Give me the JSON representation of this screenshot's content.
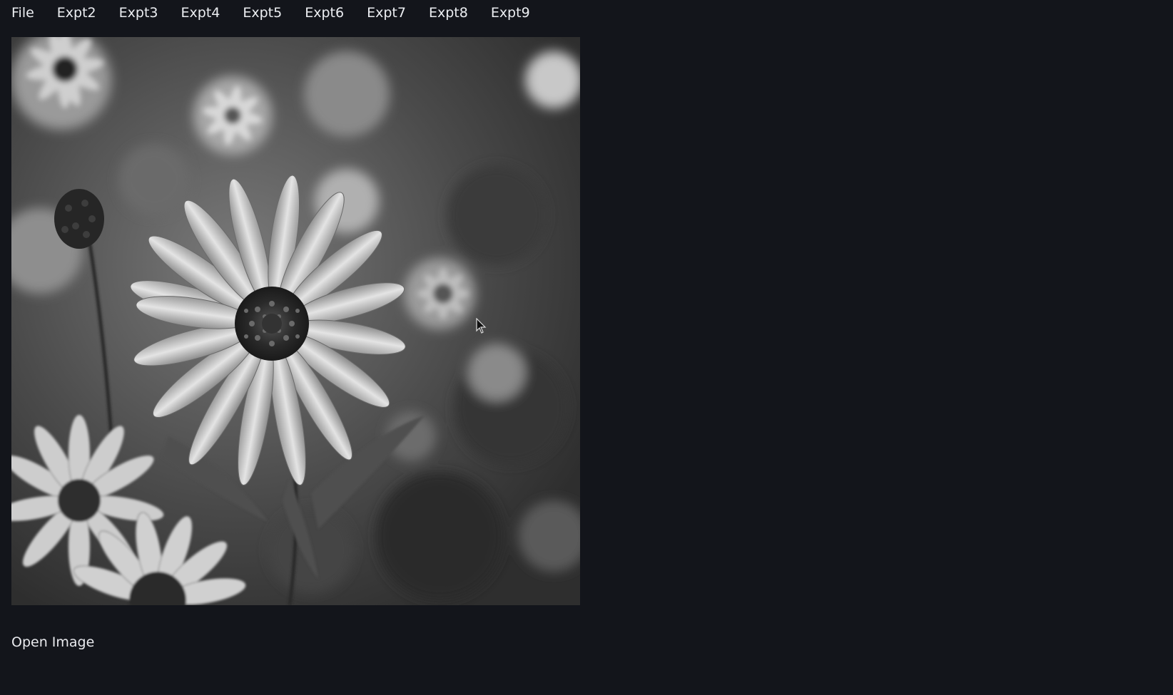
{
  "menubar": {
    "items": [
      {
        "label": "File"
      },
      {
        "label": "Expt2"
      },
      {
        "label": "Expt3"
      },
      {
        "label": "Expt4"
      },
      {
        "label": "Expt5"
      },
      {
        "label": "Expt6"
      },
      {
        "label": "Expt7"
      },
      {
        "label": "Expt8"
      },
      {
        "label": "Expt9"
      }
    ]
  },
  "image": {
    "subject": "grayscale photo of coneflowers"
  },
  "status": {
    "label": "Open Image"
  },
  "colors": {
    "background": "#13151b",
    "text": "#e9eaee"
  },
  "icons": {
    "cursor": "arrow-cursor-icon"
  }
}
